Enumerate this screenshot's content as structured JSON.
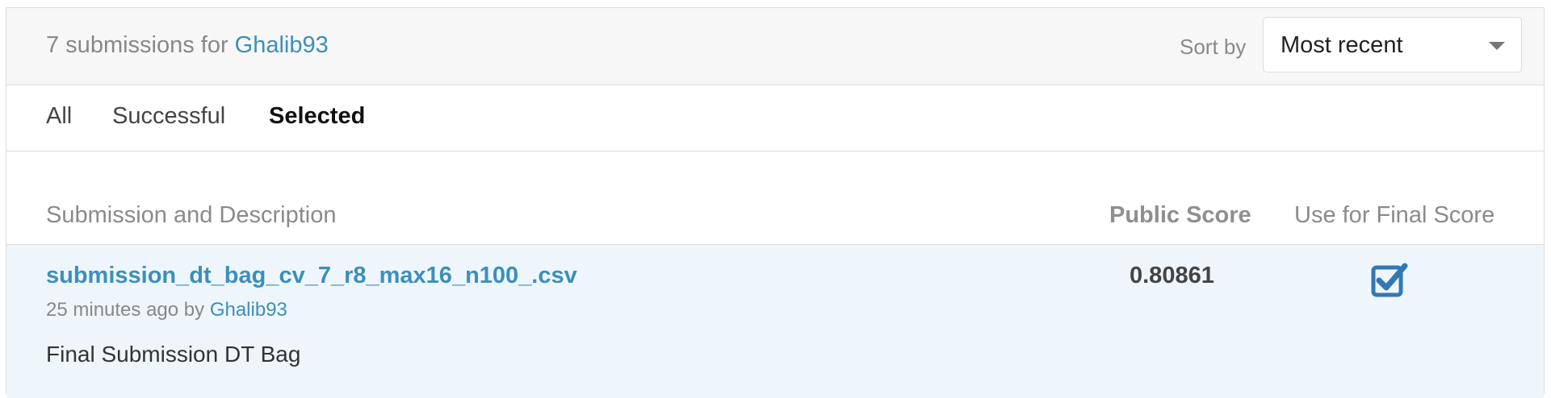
{
  "header": {
    "count_text": "7 submissions for",
    "user": "Ghalib93",
    "sort_label": "Sort by",
    "sort_value": "Most recent"
  },
  "tabs": [
    {
      "label": "All",
      "active": false
    },
    {
      "label": "Successful",
      "active": false
    },
    {
      "label": "Selected",
      "active": true
    }
  ],
  "table": {
    "columns": [
      "Submission and Description",
      "Public Score",
      "Use for Final Score"
    ],
    "rows": [
      {
        "file": "submission_dt_bag_cv_7_r8_max16_n100_.csv",
        "time": "25 minutes ago",
        "by_text": "by",
        "user": "Ghalib93",
        "description": "Final Submission DT Bag",
        "public_score": "0.80861",
        "use_for_final": true
      }
    ]
  },
  "colors": {
    "link": "#3c8fba",
    "row_highlight": "#eef6fc",
    "checkbox": "#3178b5"
  }
}
